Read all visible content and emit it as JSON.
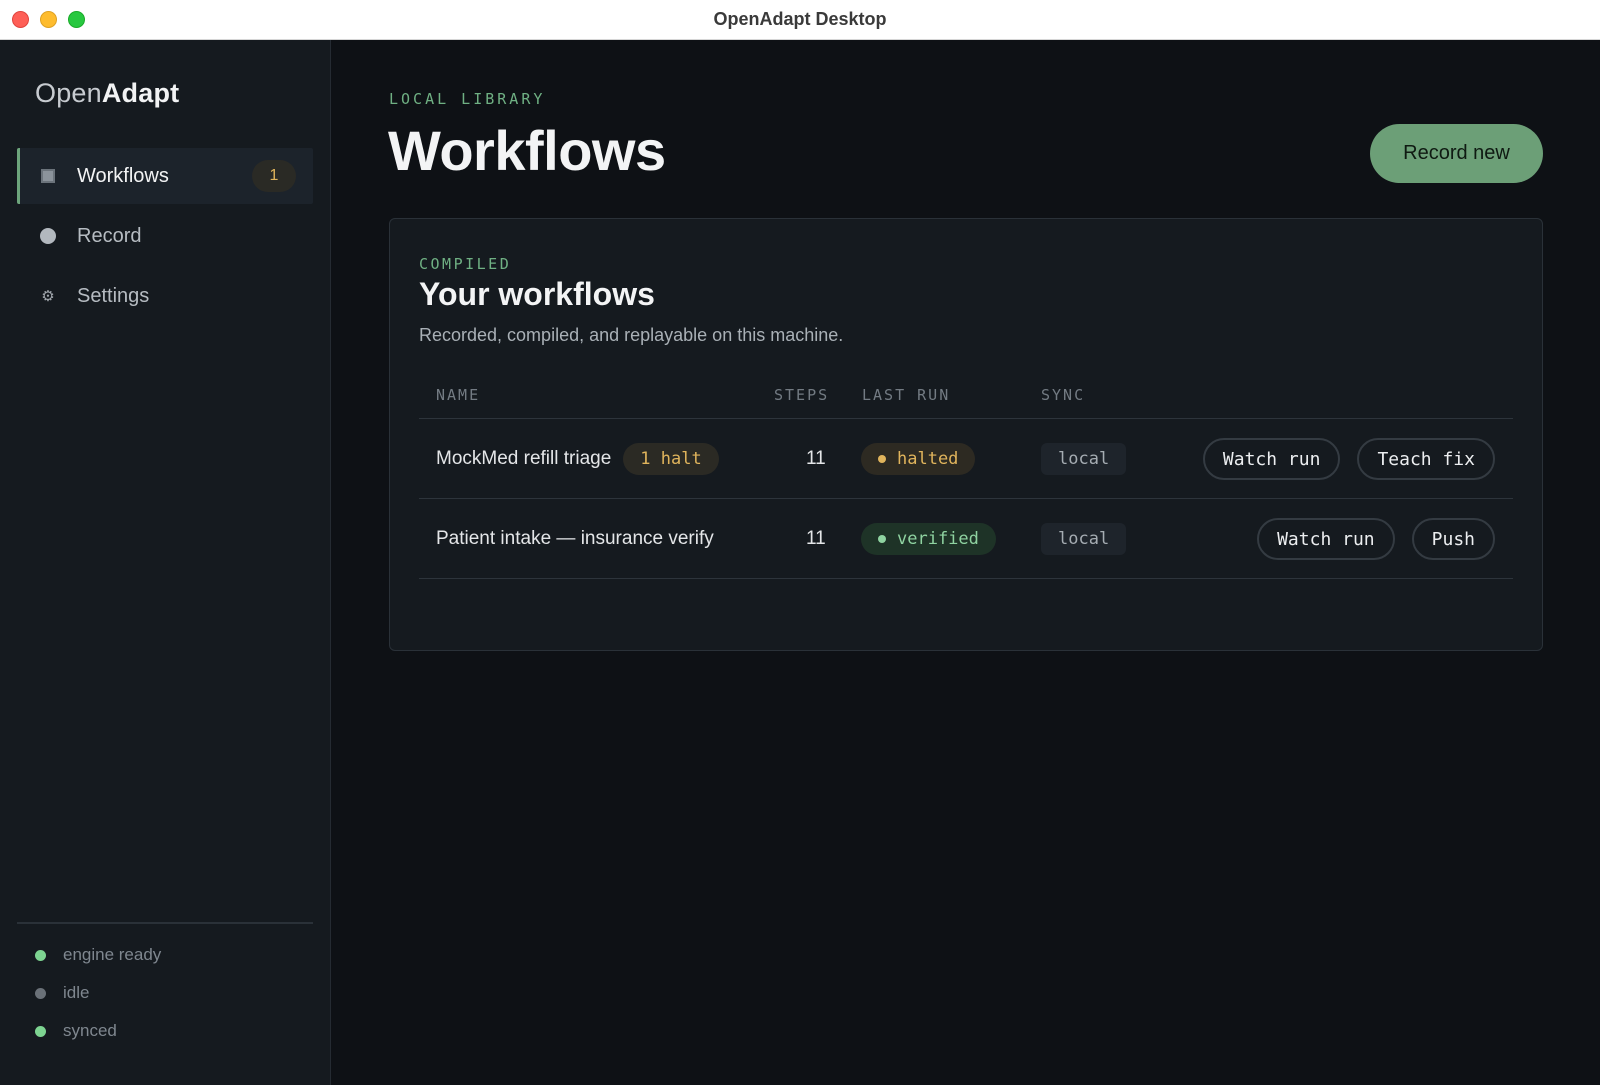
{
  "window": {
    "title": "OpenAdapt Desktop"
  },
  "brand": {
    "light": "Open",
    "bold": "Adapt"
  },
  "sidebar": {
    "items": [
      {
        "label": "Workflows",
        "badge": "1",
        "icon": "square-icon",
        "active": true
      },
      {
        "label": "Record",
        "icon": "record-dot-icon"
      },
      {
        "label": "Settings",
        "icon": "gear-icon",
        "glyph": "⚙"
      }
    ],
    "status": [
      {
        "label": "engine ready",
        "color": "#7dd491"
      },
      {
        "label": "idle",
        "color": "#6a7178"
      },
      {
        "label": "synced",
        "color": "#7dd491"
      }
    ]
  },
  "header": {
    "eyebrow": "LOCAL LIBRARY",
    "title": "Workflows",
    "record_button": "Record new"
  },
  "card": {
    "eyebrow": "COMPILED",
    "title": "Your workflows",
    "subtitle": "Recorded, compiled, and replayable on this machine.",
    "columns": [
      "NAME",
      "STEPS",
      "LAST RUN",
      "SYNC"
    ],
    "rows": [
      {
        "name": "MockMed refill triage",
        "halt": "1 halt",
        "steps": "11",
        "last_run": "halted",
        "sync": "local",
        "actions": [
          "Watch run",
          "Teach fix"
        ]
      },
      {
        "name": "Patient intake — insurance verify",
        "steps": "11",
        "last_run": "verified",
        "sync": "local",
        "actions": [
          "Watch run",
          "Push"
        ]
      }
    ]
  },
  "colors": {
    "accent": "#6c9f77",
    "warning": "#e0b45c",
    "success": "#8fd3a1",
    "background": "#0e1115",
    "panel": "#151a1f"
  }
}
